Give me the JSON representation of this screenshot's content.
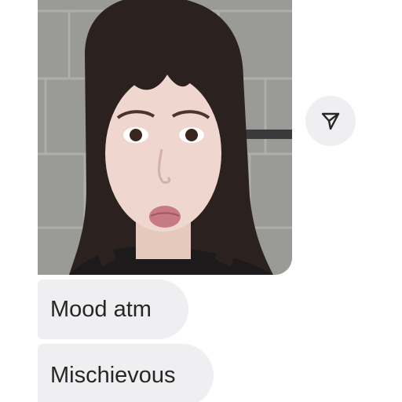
{
  "conversation": {
    "messages": [
      {
        "type": "photo",
        "alt": "selfie-photo"
      },
      {
        "type": "text",
        "text": "Mood atm"
      },
      {
        "type": "text",
        "text": "Mischievous"
      }
    ],
    "share_button": {
      "icon": "paper-plane-icon"
    }
  },
  "colors": {
    "bubble_background": "#efeff1",
    "text": "#262626",
    "page_background": "#ffffff"
  }
}
